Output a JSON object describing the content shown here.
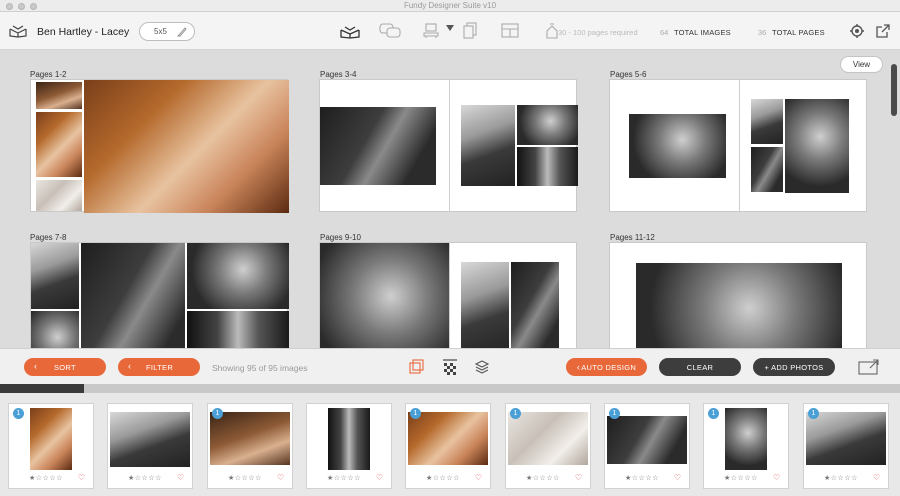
{
  "window": {
    "title": "Fundy Designer Suite v10"
  },
  "toolbar": {
    "client_name": "Ben Hartley - Lacey",
    "album_size": "5x5",
    "pages_required": "30 - 100 pages required",
    "total_images_count": "64",
    "total_images_label": "TOTAL IMAGES",
    "total_pages_count": "36",
    "total_pages_label": "TOTAL PAGES",
    "icons": [
      "album-icon",
      "chat-icon",
      "room-icon",
      "pages-icon",
      "layout-icon",
      "proof-icon",
      "settings-icon",
      "export-icon"
    ]
  },
  "main": {
    "view_label": "View",
    "spreads": [
      {
        "label": "Pages 1-2"
      },
      {
        "label": "Pages 3-4"
      },
      {
        "label": "Pages 5-6"
      },
      {
        "label": "Pages 7-8"
      },
      {
        "label": "Pages 9-10"
      },
      {
        "label": "Pages 11-12"
      }
    ]
  },
  "actionbar": {
    "sort_label": "SORT",
    "filter_label": "FILTER",
    "showing_text": "Showing 95 of 95 images",
    "auto_design_label": "AUTO DESIGN",
    "clear_label": "CLEAR",
    "add_photos_label": "+ ADD PHOTOS"
  },
  "progress": {
    "fraction": 0.093
  },
  "filmstrip": {
    "thumbnails": [
      {
        "used_count": "1",
        "rating": "★☆☆☆☆"
      },
      {
        "used_count": "",
        "rating": "★☆☆☆☆"
      },
      {
        "used_count": "1",
        "rating": "★☆☆☆☆"
      },
      {
        "used_count": "",
        "rating": "★☆☆☆☆"
      },
      {
        "used_count": "1",
        "rating": "★☆☆☆☆"
      },
      {
        "used_count": "1",
        "rating": "★☆☆☆☆"
      },
      {
        "used_count": "1",
        "rating": "★☆☆☆☆"
      },
      {
        "used_count": "1",
        "rating": "★☆☆☆☆"
      },
      {
        "used_count": "1",
        "rating": "★☆☆☆☆"
      }
    ]
  },
  "colors": {
    "accent": "#e8683a",
    "dark_button": "#3d3d3d",
    "badge": "#4a9fd6",
    "heart": "#e04040"
  }
}
